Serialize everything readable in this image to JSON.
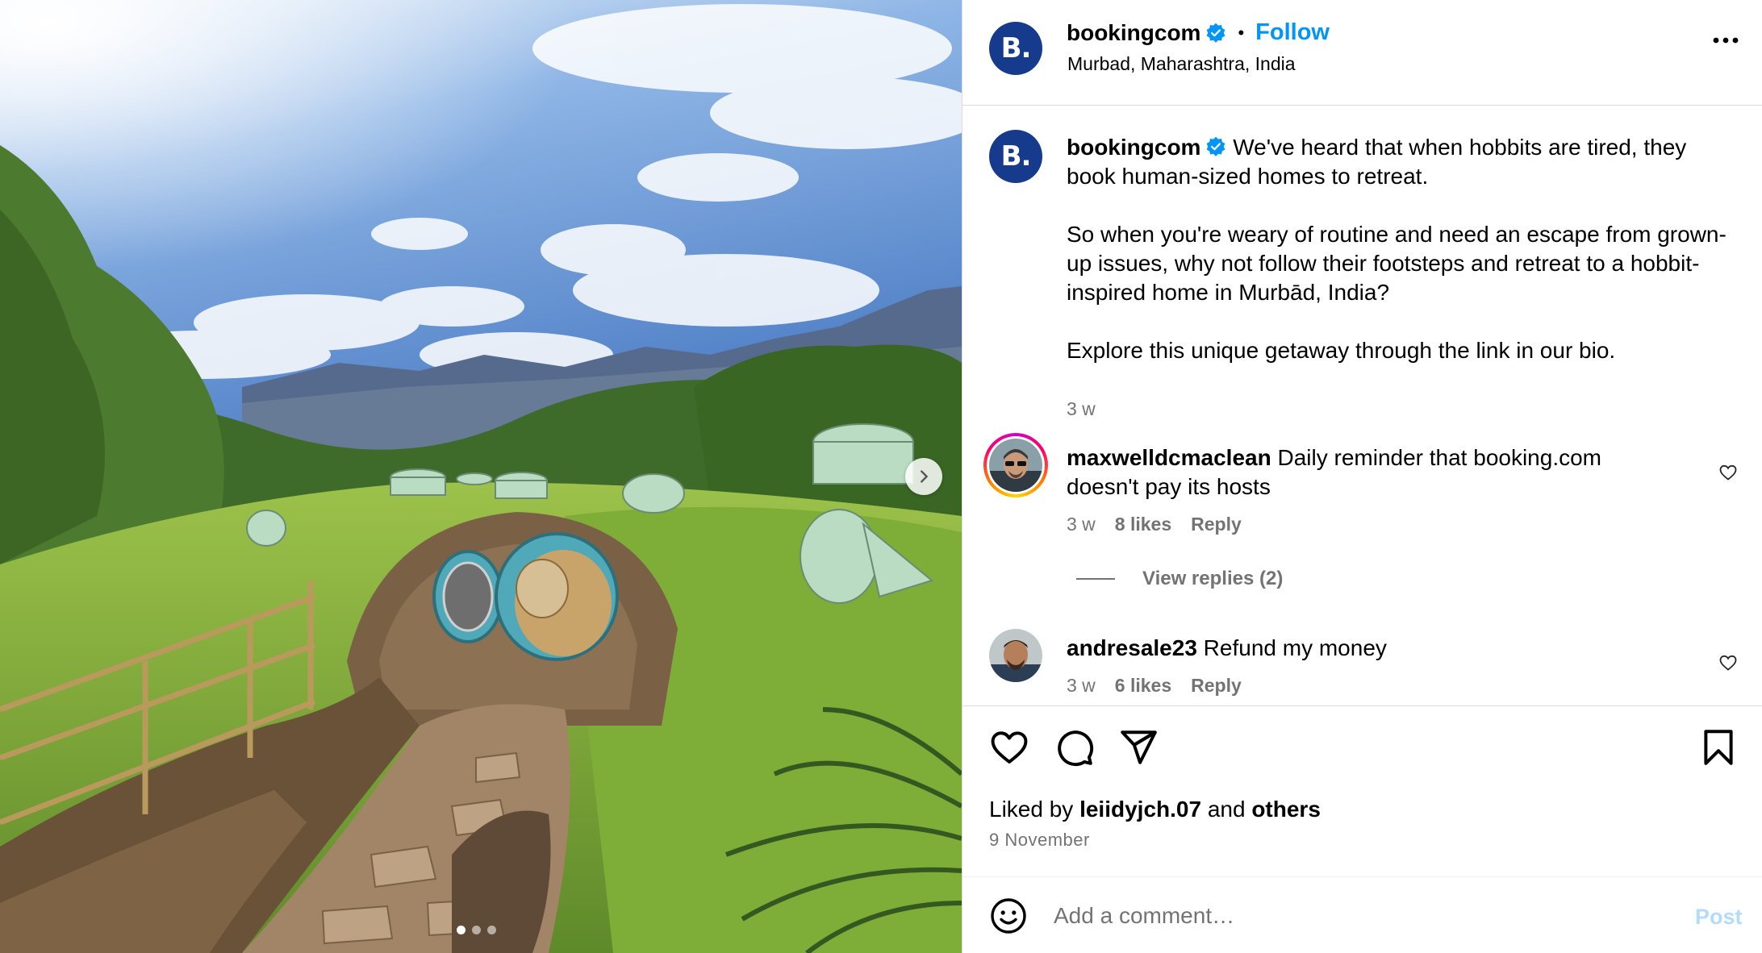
{
  "header": {
    "avatar_letter": "B.",
    "username": "bookingcom",
    "separator": "•",
    "follow_label": "Follow",
    "location": "Murbad, Maharashtra, India"
  },
  "caption": {
    "username": "bookingcom",
    "para1": "We've heard that when hobbits are tired, they book human-sized homes to retreat.",
    "para2": "So when you're weary of routine and need an escape from grown-up issues, why not follow their footsteps and retreat to a hobbit-inspired home in Murbād, India?",
    "para3": "Explore this unique getaway through the link in our bio.",
    "time": "3 w"
  },
  "comments": [
    {
      "username": "maxwelldcmaclean",
      "text": "Daily reminder that booking.com doesn't pay its hosts",
      "time": "3 w",
      "likes": "8 likes",
      "reply_label": "Reply",
      "view_replies": "View replies (2)"
    },
    {
      "username": "andresale23",
      "text": "Refund my money",
      "time": "3 w",
      "likes": "6 likes",
      "reply_label": "Reply"
    }
  ],
  "likes": {
    "prefix": "Liked by",
    "user": "leiidyjch.07",
    "and": "and",
    "others": "others"
  },
  "post_date": "9 November",
  "comment_box": {
    "placeholder": "Add a comment…",
    "post_label": "Post"
  },
  "carousel": {
    "slides": 3,
    "active_index": 0
  },
  "colors": {
    "accent": "#0095f6",
    "brand": "#163a8c",
    "muted": "#737373",
    "post_disabled": "#b3dbff"
  },
  "icons": [
    "chevron-right-icon",
    "verified-badge-icon",
    "more-options-icon",
    "heart-icon",
    "comment-icon",
    "share-icon",
    "bookmark-icon",
    "emoji-icon"
  ]
}
